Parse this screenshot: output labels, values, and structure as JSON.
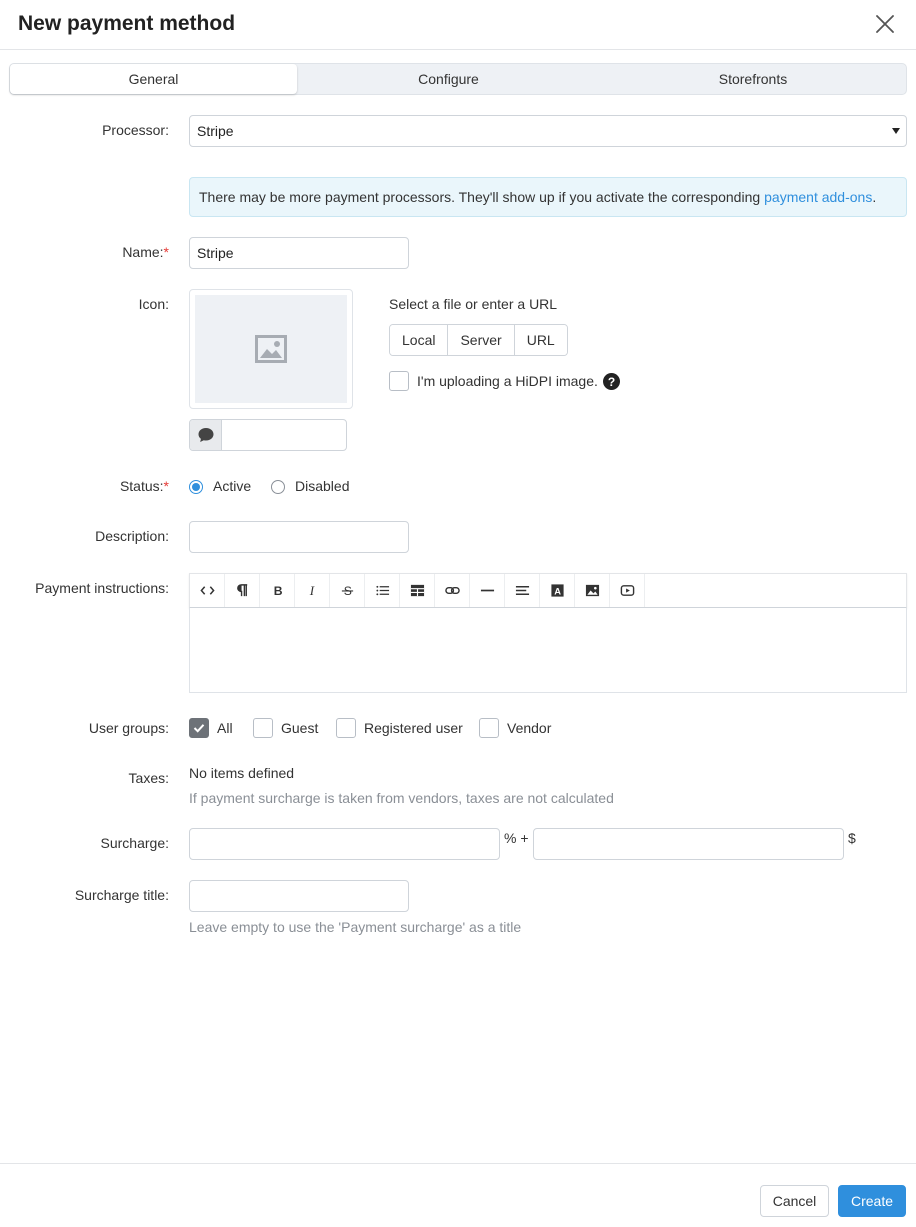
{
  "dialog": {
    "title": "New payment method"
  },
  "tabs": [
    {
      "label": "General",
      "active": true
    },
    {
      "label": "Configure",
      "active": false
    },
    {
      "label": "Storefronts",
      "active": false
    }
  ],
  "form": {
    "processor": {
      "label": "Processor:",
      "value": "Stripe"
    },
    "notice": {
      "text": "There may be more payment processors. They'll show up if you activate the corresponding",
      "link": "payment add-ons",
      "suffix": "."
    },
    "name": {
      "label": "Name:",
      "required": "*",
      "value": "Stripe"
    },
    "icon": {
      "label": "Icon:",
      "select_text": "Select a file or enter a URL",
      "sources": [
        "Local",
        "Server",
        "URL"
      ],
      "hidpi_label": "I'm uploading a HiDPI image.",
      "help": "?"
    },
    "status": {
      "label": "Status:",
      "required": "*",
      "options": [
        "Active",
        "Disabled"
      ],
      "selected": "Active"
    },
    "description": {
      "label": "Description:",
      "value": ""
    },
    "payment_instructions": {
      "label": "Payment instructions:",
      "toolbar": [
        "code-view",
        "paragraph",
        "bold",
        "italic",
        "strikethrough",
        "list",
        "table",
        "link",
        "horizontal-rule",
        "align",
        "font-color",
        "image",
        "video"
      ]
    },
    "user_groups": {
      "label": "User groups:",
      "options": [
        {
          "label": "All",
          "checked": true
        },
        {
          "label": "Guest",
          "checked": false
        },
        {
          "label": "Registered user",
          "checked": false
        },
        {
          "label": "Vendor",
          "checked": false
        }
      ]
    },
    "taxes": {
      "label": "Taxes:",
      "value": "No items defined",
      "hint": "If payment surcharge is taken from vendors, taxes are not calculated"
    },
    "surcharge": {
      "label": "Surcharge:",
      "percent_suffix": "% +",
      "currency_suffix": "$"
    },
    "surcharge_title": {
      "label": "Surcharge title:",
      "hint": "Leave empty to use the 'Payment surcharge' as a title"
    }
  },
  "footer": {
    "cancel": "Cancel",
    "create": "Create"
  },
  "colors": {
    "accent": "#2f8fdd",
    "required": "#e53935"
  }
}
